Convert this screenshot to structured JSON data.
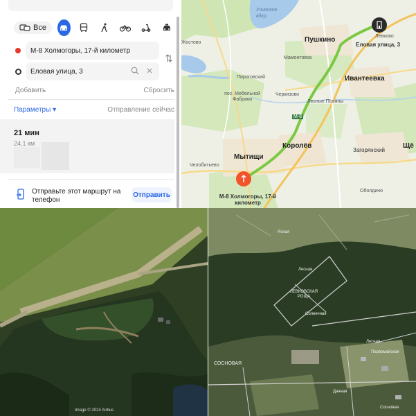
{
  "route_panel": {
    "modes": {
      "all_label": "Все",
      "items": [
        "car-icon",
        "bus-icon",
        "walk-icon",
        "bicycle-icon",
        "scooter-icon",
        "taxi-icon"
      ]
    },
    "from": "М-8 Холмогоры, 17-й километр",
    "to": "Еловая улица, 3",
    "add_label": "Добавить",
    "reset_label": "Сбросить",
    "params_label": "Параметры ▾",
    "departure_label": "Отправление сейчас",
    "result": {
      "time": "21 мин",
      "distance": "24,1 км"
    },
    "send": {
      "text": "Отправьте этот маршрут на телефон",
      "button": "Отправить"
    }
  },
  "map": {
    "labels": {
      "uchinskoe": "Учинское вдхр.",
      "pushkino": "Пушкино",
      "levkovo": "Левково",
      "destination": "Еловая улица, 3",
      "zhostovo": "Жостово",
      "mamontovka": "Мамонтовка",
      "pirogovsky": "Пироговский",
      "ivanteevka": "Ивантеевка",
      "mebelnoy": "пос. Мебельной Фабрики",
      "cherkizovo": "Черкизово",
      "lesnye": "Лесные Поляны",
      "korolev": "Королёв",
      "zagoryansky": "Загорянский",
      "shche": "Щё",
      "mytishchi": "Мытищи",
      "chelobitevo": "Челобитьево",
      "oboldino": "Оболдино",
      "origin": "М-8 Холмогоры, 17-й километр",
      "highway": "Ярославское ш.",
      "m8": "М-8",
      "reservoir": "вдхр.",
      "klyazma": "р. Клязьма"
    },
    "route_color": "#7ac943",
    "origin_pin_color": "#f2532b",
    "dest_pin_color": "#2b2b2b"
  },
  "satellite": {
    "copyright": "Image © 2024 Airbus",
    "labels": {
      "levkovskaya": "ЛЕВКОВСКАЯ РОЩА",
      "sosnovaya": "СОСНОВАЯ",
      "yasnaya": "Ясная",
      "lesnaya": "Лесная",
      "solnechnaya": "Солнечная",
      "lesnaya2": "Лесная",
      "pervomayskaya": "Первомайская",
      "dachnaya": "Дачная",
      "sosnovaya2": "Сосновая"
    }
  }
}
